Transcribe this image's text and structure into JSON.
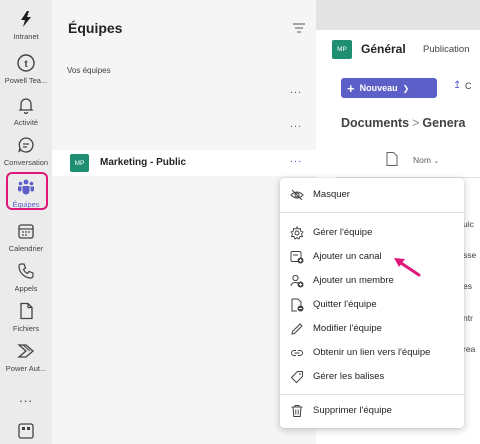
{
  "rail": {
    "items": [
      {
        "label": "Intranet",
        "icon": "intranet-logo-icon"
      },
      {
        "label": "Powell Tea...",
        "icon": "powell-teams-icon"
      },
      {
        "label": "Activité",
        "icon": "bell-icon"
      },
      {
        "label": "Conversation",
        "icon": "chat-icon"
      },
      {
        "label": "Équipes",
        "icon": "teams-icon",
        "active": true
      },
      {
        "label": "Calendrier",
        "icon": "calendar-icon"
      },
      {
        "label": "Appels",
        "icon": "phone-icon"
      },
      {
        "label": "Fichiers",
        "icon": "file-icon"
      },
      {
        "label": "Power Aut...",
        "icon": "power-automate-icon"
      }
    ],
    "more": "...",
    "highlight_color": "#e0177a"
  },
  "teams_panel": {
    "title": "Équipes",
    "section_label": "Vos équipes",
    "more": "...",
    "team": {
      "avatar": "MP",
      "name": "Marketing - Public",
      "more": "..."
    }
  },
  "channel": {
    "avatar": "MP",
    "name": "Général",
    "tab": "Publication",
    "new_button": "Nouveau",
    "upload_fragment": "C",
    "breadcrumb_root": "Documents",
    "breadcrumb_sep": ">",
    "breadcrumb_current": "Genera",
    "column_name": "Nom",
    "row_fragments": [
      "uic",
      "sse",
      "es",
      "ntr",
      "rea"
    ]
  },
  "menu": {
    "items": [
      {
        "label": "Masquer",
        "icon": "hide-icon"
      },
      {
        "label": "Gérer l'équipe",
        "icon": "gear-icon"
      },
      {
        "label": "Ajouter un canal",
        "icon": "add-channel-icon"
      },
      {
        "label": "Ajouter un membre",
        "icon": "add-member-icon"
      },
      {
        "label": "Quitter l'équipe",
        "icon": "leave-team-icon"
      },
      {
        "label": "Modifier l'équipe",
        "icon": "pencil-icon"
      },
      {
        "label": "Obtenir un lien vers l'équipe",
        "icon": "link-icon"
      },
      {
        "label": "Gérer les balises",
        "icon": "tag-icon"
      },
      {
        "label": "Supprimer l'équipe",
        "icon": "trash-icon"
      }
    ]
  },
  "colors": {
    "brand": "#5b5fc7",
    "avatar": "#1f8f72",
    "annotation": "#e0177a"
  }
}
